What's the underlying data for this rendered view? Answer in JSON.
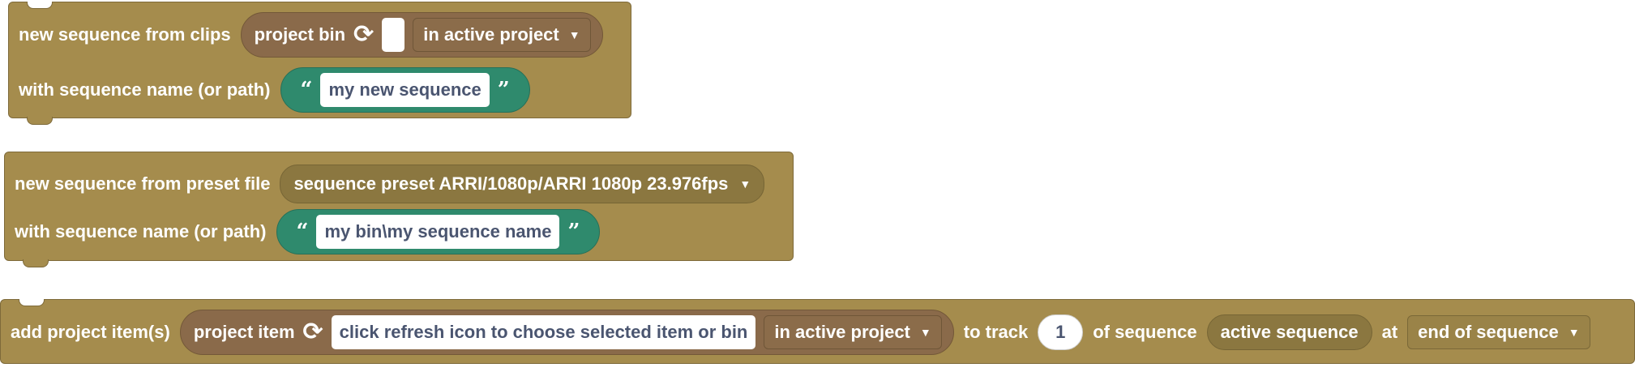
{
  "block1": {
    "label": "new sequence from clips",
    "source_label": "project bin",
    "refresh_icon": "refresh-icon",
    "scope_dropdown": "in active project",
    "name_label": "with sequence name (or path)",
    "name_value": "my new sequence"
  },
  "block2": {
    "label": "new sequence from preset file",
    "preset_dropdown": "sequence preset  ARRI/1080p/ARRI 1080p 23.976fps",
    "name_label": "with sequence name (or path)",
    "name_value": "my bin\\my sequence name"
  },
  "block3": {
    "label": "add project item(s)",
    "item_label": "project item",
    "refresh_icon": "refresh-icon",
    "item_value": "click refresh icon to choose selected item or bin",
    "scope_dropdown": "in active project",
    "to_track_label": "to track",
    "track_number": "1",
    "of_sequence_label": "of sequence",
    "sequence_value": "active sequence",
    "at_label": "at",
    "position_dropdown": "end of sequence"
  },
  "colors": {
    "block": "#a58c4d",
    "input_pill": "#8a6a4a",
    "string_pill": "#2f8a6d",
    "text_field": "#ffffff"
  }
}
